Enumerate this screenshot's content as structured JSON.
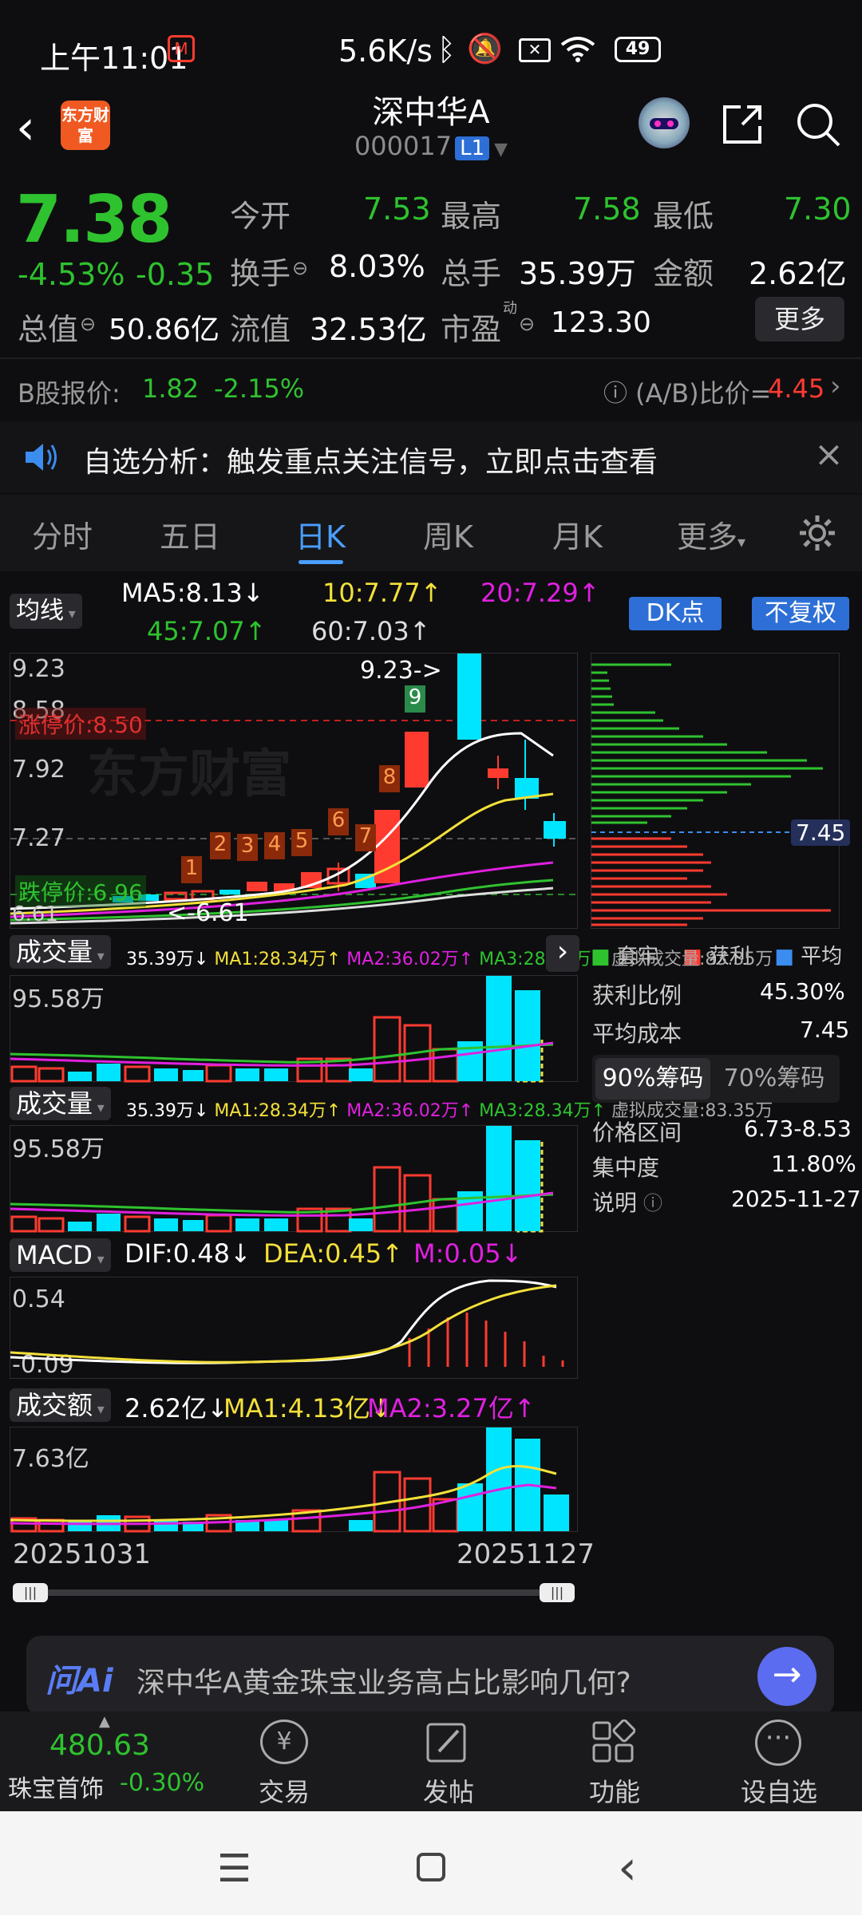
{
  "status": {
    "time": "上午11:01",
    "speed": "5.6K/s",
    "battery": "49"
  },
  "header": {
    "title": "深中华A",
    "code": "000017",
    "badge": "L1",
    "logo": "东方财富"
  },
  "quote": {
    "price": "7.38",
    "change_pct": "-4.53%",
    "change": "-0.35",
    "open_label": "今开",
    "open": "7.53",
    "high_label": "最高",
    "high": "7.58",
    "low_label": "最低",
    "low": "7.30",
    "turnover_label": "换手",
    "turnover": "8.03%",
    "vol_label": "总手",
    "vol": "35.39万",
    "amount_label": "金额",
    "amount": "2.62亿",
    "mcap_label": "总值",
    "mcap": "50.86亿",
    "float_label": "流值",
    "float": "32.53亿",
    "pe_label": "市盈",
    "pe_sup": "动",
    "pe": "123.30",
    "more": "更多"
  },
  "bshare": {
    "label": "B股报价:",
    "price": "1.82",
    "pct": "-2.15%",
    "ratio_label": "(A/B)比价=",
    "ratio": "4.45"
  },
  "notice": {
    "text": "自选分析：触发重点关注信号，立即点击查看"
  },
  "tabs": [
    "分时",
    "五日",
    "日K",
    "周K",
    "月K",
    "更多"
  ],
  "ma": {
    "selector": "均线",
    "ma5": "MA5:8.13↓",
    "ma10": "10:7.77↑",
    "ma20": "20:7.29↑",
    "ma45": "45:7.07↑",
    "ma60": "60:7.03↑",
    "dk": "DK点",
    "fq": "不复权"
  },
  "kline": {
    "y_labels": [
      "9.23",
      "8.58",
      "7.92",
      "7.27"
    ],
    "limit_up": "涨停价:8.50",
    "limit_down": "跌停价:6.96",
    "low_tag": "<-6.61",
    "high_tag": "9.23->",
    "low_left": "6.61",
    "candle_nums": [
      "1",
      "2",
      "3",
      "4",
      "5",
      "6",
      "7",
      "8",
      "9"
    ],
    "watermark": "东方财富"
  },
  "chips": {
    "cur": "7.45",
    "legend": [
      "套牢",
      "获利",
      "平均"
    ],
    "rows": [
      {
        "k": "获利比例",
        "v": "45.30%"
      },
      {
        "k": "平均成本",
        "v": "7.45"
      }
    ],
    "tab_a": "90%筹码",
    "tab_b": "70%筹码",
    "rows2": [
      {
        "k": "价格区间",
        "v": "6.73-8.53"
      },
      {
        "k": "集中度",
        "v": "11.80%"
      },
      {
        "k": "说明",
        "v": "2025-11-27"
      }
    ]
  },
  "vol1": {
    "label": "成交量",
    "info": "35.39万↓",
    "ma1": "MA1:28.34万↑",
    "ma2": "MA2:36.02万↑",
    "ma3": "MA3:28.34万↑",
    "virt": "虚拟成交量:83.35万",
    "ymax": "95.58万"
  },
  "vol2": {
    "label": "成交量",
    "info": "35.39万↓",
    "ma1": "MA1:28.34万↑",
    "ma2": "MA2:36.02万↑",
    "ma3": "MA3:28.34万↑",
    "virt": "虚拟成交量:83.35万",
    "ymax": "95.58万"
  },
  "macd": {
    "label": "MACD",
    "dif": "DIF:0.48↓",
    "dea": "DEA:0.45↑",
    "m": "M:0.05↓",
    "ytop": "0.54",
    "ybot": "-0.09"
  },
  "amt": {
    "label": "成交额",
    "val": "2.62亿↓",
    "ma1": "MA1:4.13亿↓",
    "ma2": "MA2:3.27亿↑",
    "ymax": "7.63亿"
  },
  "dates": {
    "start": "20251031",
    "end": "20251127"
  },
  "ask": {
    "logo": "问Ai",
    "text": "深中华A黄金珠宝业务高占比影响几何?"
  },
  "bottom": {
    "index_val": "480.63",
    "index_name": "珠宝首饰",
    "index_pct": "-0.30%",
    "items": [
      "交易",
      "发帖",
      "功能",
      "设自选"
    ]
  },
  "colors": {
    "up": "#ff3b30",
    "down": "#2fc22f",
    "accent": "#4a9eff",
    "cyan": "#00ffff"
  }
}
